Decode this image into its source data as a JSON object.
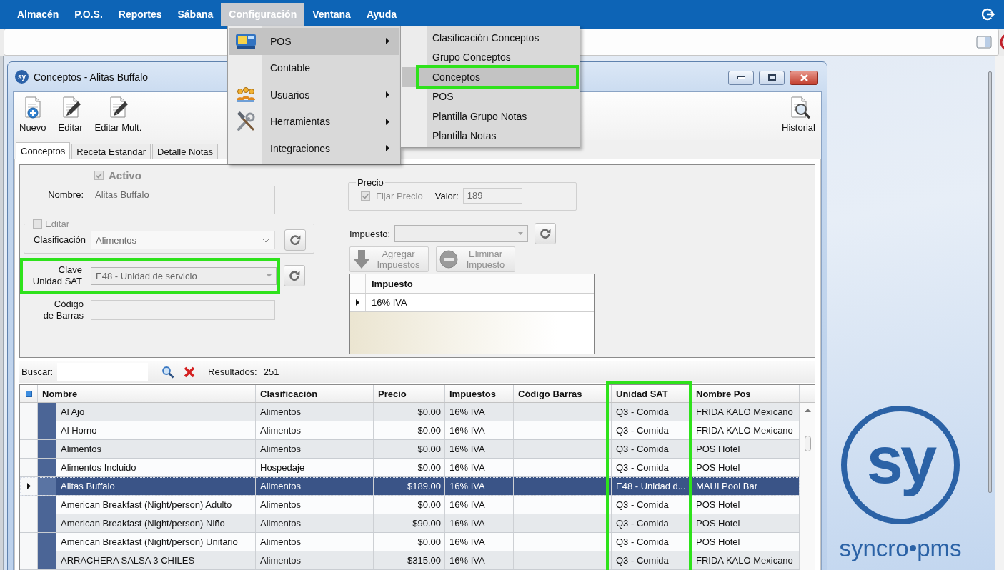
{
  "menubar": {
    "items": [
      {
        "label": "Almacén",
        "selected": false
      },
      {
        "label": "P.O.S.",
        "selected": false
      },
      {
        "label": "Reportes",
        "selected": false
      },
      {
        "label": "Sábana",
        "selected": false
      },
      {
        "label": "Configuración",
        "selected": true
      },
      {
        "label": "Ventana",
        "selected": false
      },
      {
        "label": "Ayuda",
        "selected": false
      }
    ]
  },
  "menu": {
    "items": [
      {
        "label": "POS",
        "kind": "pos",
        "selected": true,
        "has_submenu": true
      },
      {
        "label": "Contable",
        "kind": "accounting",
        "selected": false,
        "has_submenu": false
      },
      {
        "label": "Usuarios",
        "kind": "users",
        "selected": false,
        "has_submenu": true
      },
      {
        "label": "Herramientas",
        "kind": "tools",
        "selected": false,
        "has_submenu": true
      },
      {
        "label": "Integraciones",
        "kind": "integrations",
        "selected": false,
        "has_submenu": true
      }
    ]
  },
  "submenu": {
    "items": [
      {
        "label": "Clasificación Conceptos",
        "selected": false,
        "outlined": false
      },
      {
        "label": "Grupo Conceptos",
        "selected": false,
        "outlined": false
      },
      {
        "label": "Conceptos",
        "selected": true,
        "outlined": true
      },
      {
        "label": "POS",
        "selected": false,
        "outlined": false
      },
      {
        "label": "Plantilla Grupo Notas",
        "selected": false,
        "outlined": false
      },
      {
        "label": "Plantilla Notas",
        "selected": false,
        "outlined": false
      }
    ]
  },
  "window": {
    "icon_text": "sy",
    "title": "Conceptos - Alitas Buffalo"
  },
  "toolbar": {
    "buttons": [
      {
        "label": "Nuevo",
        "kind": "new"
      },
      {
        "label": "Editar",
        "kind": "edit"
      },
      {
        "label": "Editar Mult.",
        "kind": "edit"
      }
    ],
    "history_button": {
      "label": "Historial"
    }
  },
  "tabs": [
    {
      "label": "Conceptos",
      "selected": true
    },
    {
      "label": "Receta Estandar",
      "selected": false
    },
    {
      "label": "Detalle Notas",
      "selected": false
    }
  ],
  "form": {
    "activo": {
      "label": "Activo",
      "checked": true,
      "disabled": true
    },
    "nombre": {
      "label": "Nombre:",
      "value": "Alitas Buffalo"
    },
    "editar": {
      "label": "Editar",
      "checked": false,
      "disabled": true
    },
    "clasificacion": {
      "label": "Clasificación",
      "value": "Alimentos"
    },
    "clave_unidad_sat": {
      "label": "Clave\nUnidad SAT",
      "value": "E48 - Unidad de servicio",
      "outlined": true
    },
    "codigo_barras": {
      "label": "Código\nde Barras"
    },
    "precio": {
      "title": "Precio",
      "fijar_precio": {
        "label": "Fijar Precio",
        "checked": true,
        "disabled": true
      },
      "valor_label": "Valor:",
      "valor": "189"
    },
    "impuesto": {
      "label": "Impuesto:"
    },
    "tax_buttons": [
      {
        "label": "Agregar Impuestos",
        "kind": "add",
        "disabled": true
      },
      {
        "label": "Eliminar Impuesto",
        "kind": "remove",
        "disabled": true
      }
    ],
    "tax_grid": {
      "columns": [
        "Impuesto"
      ],
      "rows": [
        {
          "cells": [
            "16% IVA"
          ],
          "selected": true
        }
      ]
    }
  },
  "search": {
    "label": "Buscar:",
    "results_label": "Resultados:",
    "results_count": "251"
  },
  "grid": {
    "columns": [
      {
        "label": "Nombre",
        "outlined": false
      },
      {
        "label": "Clasificación",
        "outlined": false
      },
      {
        "label": "Precio",
        "outlined": false
      },
      {
        "label": "Impuestos",
        "outlined": false
      },
      {
        "label": "Código Barras",
        "outlined": false
      },
      {
        "label": "Unidad SAT",
        "outlined": true
      },
      {
        "label": "Nombre Pos",
        "outlined": false
      }
    ],
    "rows": [
      {
        "cells": [
          "Al Ajo",
          "Alimentos",
          "$0.00",
          "16% IVA",
          null,
          "Q3 - Comida",
          "FRIDA KALO Mexicano"
        ],
        "selected": false
      },
      {
        "cells": [
          "Al Horno",
          "Alimentos",
          "$0.00",
          "16% IVA",
          null,
          "Q3 - Comida",
          "FRIDA KALO Mexicano"
        ],
        "selected": false
      },
      {
        "cells": [
          "Alimentos",
          "Alimentos",
          "$0.00",
          "16% IVA",
          null,
          "Q3 - Comida",
          "POS Hotel"
        ],
        "selected": false
      },
      {
        "cells": [
          "Alimentos Incluido",
          "Hospedaje",
          "$0.00",
          "16% IVA",
          null,
          "Q3 - Comida",
          "POS Hotel"
        ],
        "selected": false
      },
      {
        "cells": [
          "Alitas Buffalo",
          "Alimentos",
          "$189.00",
          "16% IVA",
          null,
          "E48 - Unidad d...",
          "MAUI Pool Bar"
        ],
        "selected": true
      },
      {
        "cells": [
          "American Breakfast (Night/person) Adulto",
          "Alimentos",
          "$0.00",
          "16% IVA",
          null,
          "Q3 - Comida",
          "POS Hotel"
        ],
        "selected": false
      },
      {
        "cells": [
          "American Breakfast (Night/person) Niño",
          "Alimentos",
          "$90.00",
          "16% IVA",
          null,
          "Q3 - Comida",
          "POS Hotel"
        ],
        "selected": false
      },
      {
        "cells": [
          "American Breakfast (Night/person) Unitario",
          "Alimentos",
          "$0.00",
          "16% IVA",
          null,
          "Q3 - Comida",
          "POS Hotel"
        ],
        "selected": false
      },
      {
        "cells": [
          "ARRACHERA SALSA 3 CHILES",
          "Alimentos",
          "$315.00",
          "16% IVA",
          null,
          "Q3 - Comida",
          "FRIDA KALO Mexicano"
        ],
        "selected": false
      }
    ]
  },
  "brand": {
    "mark": "sy",
    "name": "syncro•pms"
  }
}
